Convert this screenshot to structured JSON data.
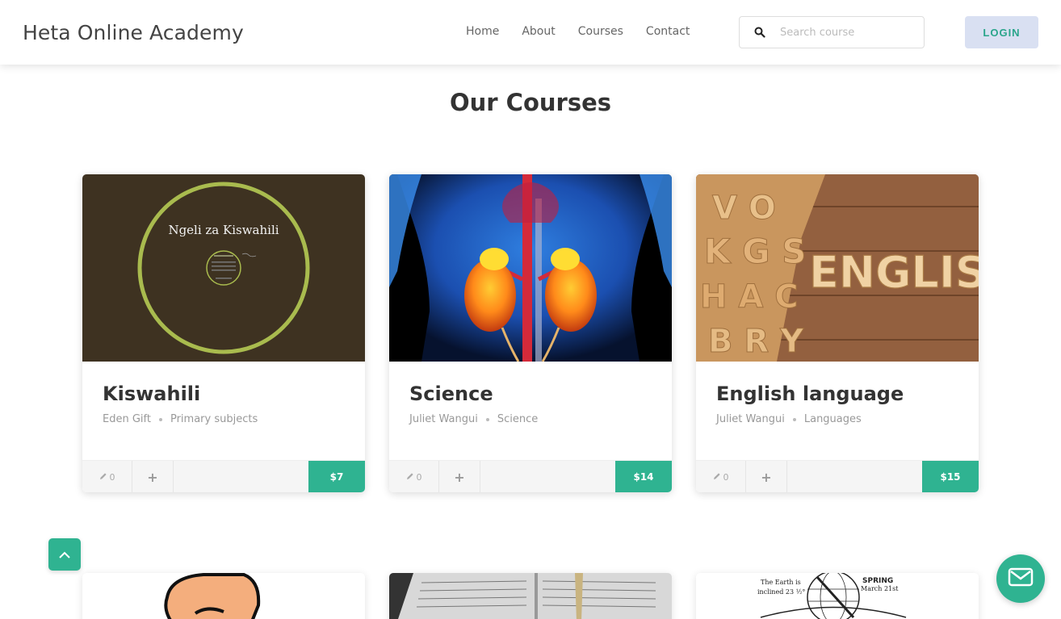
{
  "header": {
    "brand": "Heta Online Academy",
    "nav": [
      "Home",
      "About",
      "Courses",
      "Contact"
    ],
    "search_placeholder": "Search course",
    "login_label": "LOGIN"
  },
  "section_title": "Our Courses",
  "courses": [
    {
      "title": "Kiswahili",
      "author": "Eden Gift",
      "category": "Primary subjects",
      "edits": "0",
      "price": "$7",
      "image_text": "Ngeli za Kiswahili"
    },
    {
      "title": "Science",
      "author": "Juliet Wangui",
      "category": "Science",
      "edits": "0",
      "price": "$14"
    },
    {
      "title": "English language",
      "author": "Juliet Wangui",
      "category": "Languages",
      "edits": "0",
      "price": "$15",
      "image_text": "ENGLISH"
    }
  ],
  "row2": {
    "globe_text1": "The Earth is",
    "globe_text2": "inclined 23 ½°",
    "globe_spring": "SPRING",
    "globe_date": "March 21st"
  },
  "colors": {
    "accent": "#2fb391",
    "login_bg": "#d9e0f2"
  },
  "icons": {
    "search": "search-icon",
    "edit": "pencil-icon",
    "plus": "plus-icon",
    "scroll_top": "chevron-up-icon",
    "mail": "mail-icon"
  }
}
